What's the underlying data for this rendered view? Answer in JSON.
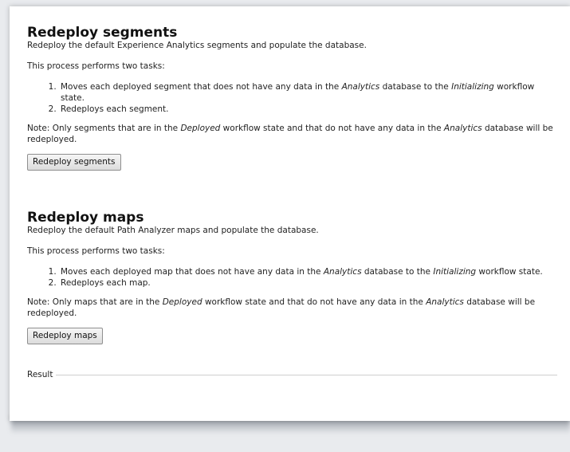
{
  "segments": {
    "title": "Redeploy segments",
    "subtitle": "Redeploy the default Experience Analytics segments and populate the database.",
    "intro": "This process performs two tasks:",
    "steps": [
      {
        "pre": "Moves each deployed segment that does not have any data in the ",
        "em1": "Analytics",
        "mid": " database to the ",
        "em2": "Initializing",
        "post": " workflow state."
      },
      {
        "text": "Redeploys each segment."
      }
    ],
    "note": {
      "pre": "Note: Only segments that are in the ",
      "em1": "Deployed",
      "mid": " workflow state and that do not have any data in the ",
      "em2": "Analytics",
      "post": " database will be redeployed."
    },
    "button_label": "Redeploy segments"
  },
  "maps": {
    "title": "Redeploy maps",
    "subtitle": "Redeploy the default Path Analyzer maps and populate the database.",
    "intro": "This process performs two tasks:",
    "steps": [
      {
        "pre": "Moves each deployed map that does not have any data in the ",
        "em1": "Analytics",
        "mid": " database to the ",
        "em2": "Initializing",
        "post": " workflow state."
      },
      {
        "text": "Redeploys each map."
      }
    ],
    "note": {
      "pre": "Note: Only maps that are in the ",
      "em1": "Deployed",
      "mid": " workflow state and that do not have any data in the ",
      "em2": "Analytics",
      "post": " database will be redeployed."
    },
    "button_label": "Redeploy maps"
  },
  "result": {
    "label": "Result"
  }
}
